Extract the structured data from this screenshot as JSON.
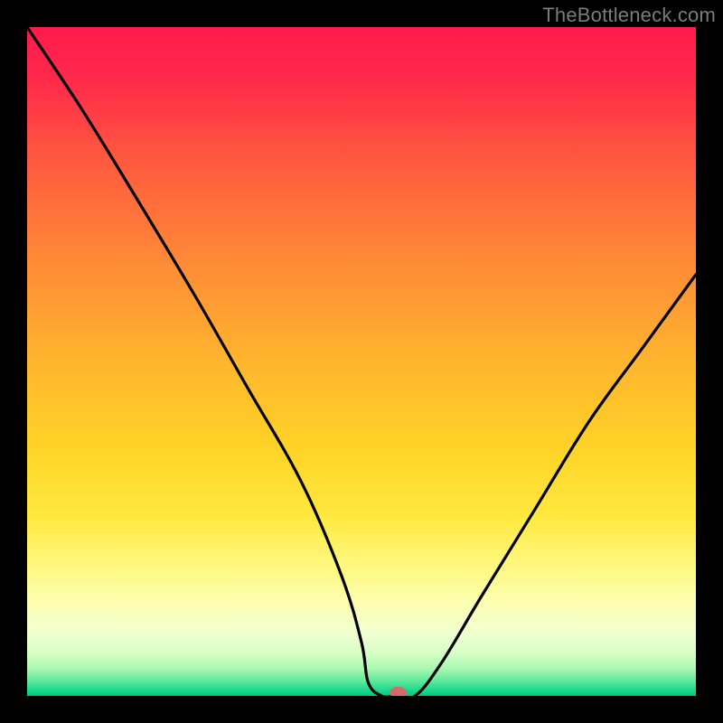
{
  "watermark": "TheBottleneck.com",
  "colors": {
    "frame": "#000000",
    "curve": "#000000",
    "marker": "#d46a6a",
    "gradient_stops": [
      {
        "offset": 0,
        "color": "#ff1a4d"
      },
      {
        "offset": 0.08,
        "color": "#ff2a4a"
      },
      {
        "offset": 0.2,
        "color": "#ff5a3f"
      },
      {
        "offset": 0.35,
        "color": "#ff8a36"
      },
      {
        "offset": 0.5,
        "color": "#ffb52e"
      },
      {
        "offset": 0.63,
        "color": "#ffd327"
      },
      {
        "offset": 0.73,
        "color": "#ffe83e"
      },
      {
        "offset": 0.8,
        "color": "#fff77a"
      },
      {
        "offset": 0.86,
        "color": "#fcffb0"
      },
      {
        "offset": 0.905,
        "color": "#f2ffd0"
      },
      {
        "offset": 0.935,
        "color": "#d9ffc8"
      },
      {
        "offset": 0.96,
        "color": "#a8f8b0"
      },
      {
        "offset": 0.978,
        "color": "#5de89a"
      },
      {
        "offset": 0.992,
        "color": "#18d88c"
      },
      {
        "offset": 1.0,
        "color": "#00c97e"
      }
    ]
  },
  "chart_data": {
    "type": "line",
    "title": "",
    "xlabel": "",
    "ylabel": "",
    "xlim": [
      0,
      100
    ],
    "ylim": [
      0,
      100
    ],
    "series": [
      {
        "name": "bottleneck-curve",
        "x": [
          0,
          8,
          16,
          25,
          33,
          41,
          47,
          50,
          51,
          53,
          55,
          58,
          62,
          68,
          76,
          84,
          92,
          100
        ],
        "y": [
          100,
          88,
          75,
          60,
          46,
          32,
          18,
          8,
          2,
          0,
          0,
          0,
          5,
          15,
          28,
          41,
          52,
          63
        ]
      }
    ],
    "marker": {
      "x": 55.5,
      "y": 0.5
    },
    "annotations": []
  }
}
